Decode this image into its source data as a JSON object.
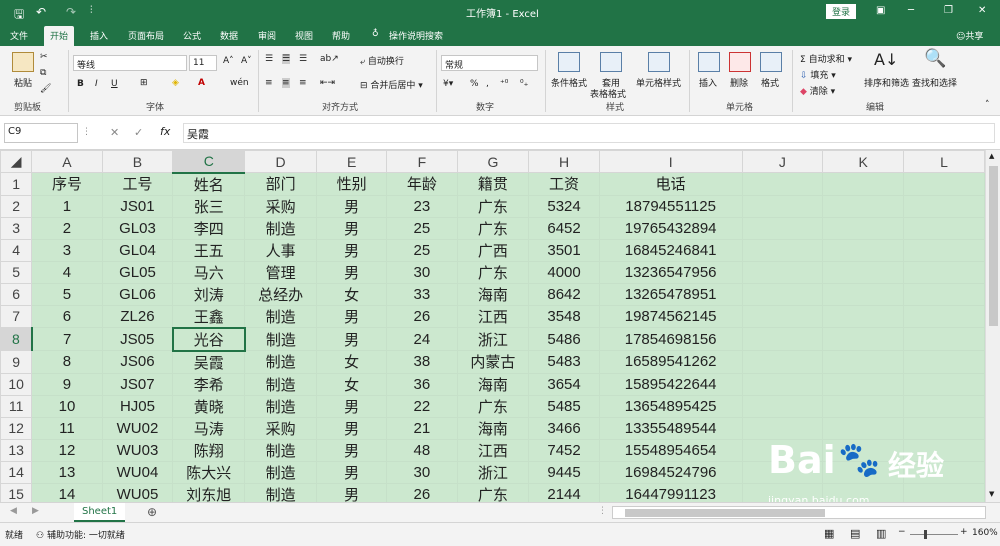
{
  "window": {
    "title": "工作簿1 - Excel",
    "login": "登录"
  },
  "tabs": [
    "文件",
    "开始",
    "插入",
    "页面布局",
    "公式",
    "数据",
    "审阅",
    "视图",
    "帮助",
    "操作说明搜索"
  ],
  "share": "共享",
  "ribbon": {
    "clipboard": {
      "paste": "粘贴",
      "group": "剪贴板"
    },
    "font": {
      "name": "等线",
      "size": "11",
      "group": "字体"
    },
    "align": {
      "wrap": "自动换行",
      "merge": "合并后居中",
      "group": "对齐方式"
    },
    "number": {
      "format": "常规",
      "group": "数字"
    },
    "styles": {
      "cond": "条件格式",
      "table_line1": "套用",
      "table_line2": "表格格式",
      "cell": "单元格样式",
      "group": "样式"
    },
    "cells": {
      "insert": "插入",
      "delete": "删除",
      "format": "格式",
      "group": "单元格"
    },
    "edit": {
      "autosum": "自动求和",
      "fill": "填充",
      "clear": "清除",
      "sort": "排序和筛选",
      "find": "查找和选择",
      "group": "编辑"
    }
  },
  "formula": {
    "cell_ref": "C9",
    "fx": "fx",
    "value": "吴霞"
  },
  "columns": [
    "A",
    "B",
    "C",
    "D",
    "E",
    "F",
    "G",
    "H",
    "I",
    "J",
    "K",
    "L"
  ],
  "rows": [
    {
      "n": "1",
      "cells": [
        "序号",
        "工号",
        "姓名",
        "部门",
        "性别",
        "年龄",
        "籍贯",
        "工资",
        "电话"
      ]
    },
    {
      "n": "2",
      "cells": [
        "1",
        "JS01",
        "张三",
        "采购",
        "男",
        "23",
        "广东",
        "5324",
        "18794551125"
      ]
    },
    {
      "n": "3",
      "cells": [
        "2",
        "GL03",
        "李四",
        "制造",
        "男",
        "25",
        "广东",
        "6452",
        "19765432894"
      ]
    },
    {
      "n": "4",
      "cells": [
        "3",
        "GL04",
        "王五",
        "人事",
        "男",
        "25",
        "广西",
        "3501",
        "16845246841"
      ]
    },
    {
      "n": "5",
      "cells": [
        "4",
        "GL05",
        "马六",
        "管理",
        "男",
        "30",
        "广东",
        "4000",
        "13236547956"
      ]
    },
    {
      "n": "6",
      "cells": [
        "5",
        "GL06",
        "刘涛",
        "总经办",
        "女",
        "33",
        "海南",
        "8642",
        "13265478951"
      ]
    },
    {
      "n": "7",
      "cells": [
        "6",
        "ZL26",
        "王鑫",
        "制造",
        "男",
        "26",
        "江西",
        "3548",
        "19874562145"
      ]
    },
    {
      "n": "8",
      "cells": [
        "7",
        "JS05",
        "光谷",
        "制造",
        "男",
        "24",
        "浙江",
        "5486",
        "17854698156"
      ]
    },
    {
      "n": "9",
      "cells": [
        "8",
        "JS06",
        "吴霞",
        "制造",
        "女",
        "38",
        "内蒙古",
        "5483",
        "16589541262"
      ]
    },
    {
      "n": "10",
      "cells": [
        "9",
        "JS07",
        "李希",
        "制造",
        "女",
        "36",
        "海南",
        "3654",
        "15895422644"
      ]
    },
    {
      "n": "11",
      "cells": [
        "10",
        "HJ05",
        "黄晓",
        "制造",
        "男",
        "22",
        "广东",
        "5485",
        "13654895425"
      ]
    },
    {
      "n": "12",
      "cells": [
        "11",
        "WU02",
        "马涛",
        "采购",
        "男",
        "21",
        "海南",
        "3466",
        "13355489544"
      ]
    },
    {
      "n": "13",
      "cells": [
        "12",
        "WU03",
        "陈翔",
        "制造",
        "男",
        "48",
        "江西",
        "7452",
        "15548954654"
      ]
    },
    {
      "n": "14",
      "cells": [
        "13",
        "WU04",
        "陈大兴",
        "制造",
        "男",
        "30",
        "浙江",
        "9445",
        "16984524796"
      ]
    },
    {
      "n": "15",
      "cells": [
        "14",
        "WU05",
        "刘东旭",
        "制造",
        "男",
        "26",
        "广东",
        "2144",
        "16447991123"
      ]
    }
  ],
  "sheet": {
    "tab": "Sheet1"
  },
  "status": {
    "mode": "就绪",
    "accessibility": "辅助功能: 一切就绪",
    "zoom": "160%"
  },
  "watermark": {
    "brand": "Bai",
    "brand2": "经验",
    "url": "jingyan.baidu.com"
  },
  "colors": {
    "excel_green": "#217346",
    "cell_fill": "#cce8cf"
  }
}
